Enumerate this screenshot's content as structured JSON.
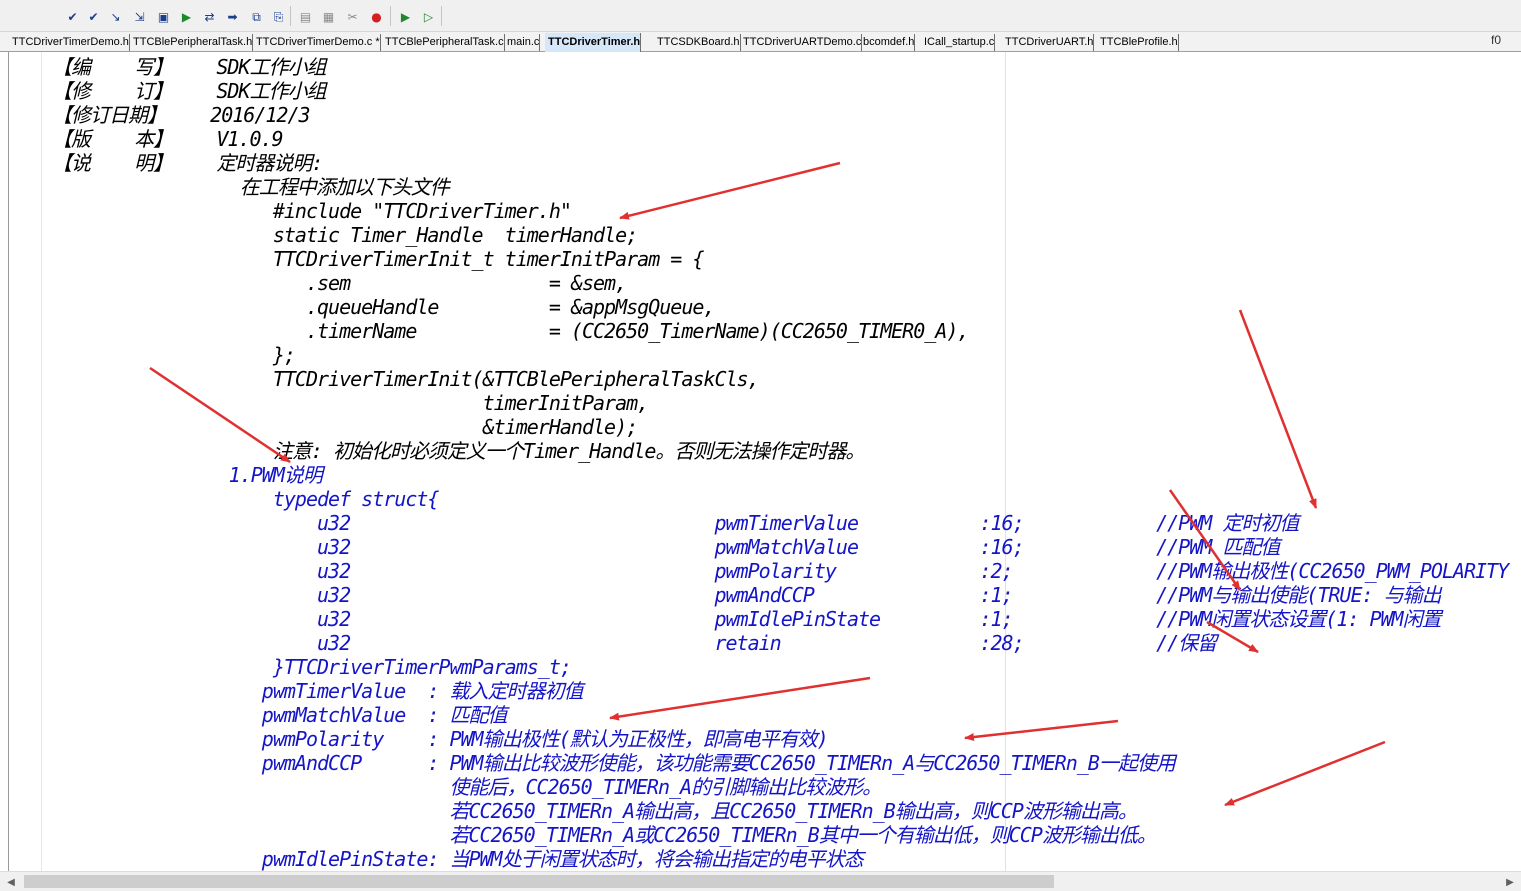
{
  "toolbar": {
    "buttons": [
      {
        "icon": "check-icon",
        "glyph": "✔"
      },
      {
        "icon": "double-check-icon",
        "glyph": "✔"
      },
      {
        "icon": "check-arrow-icon",
        "glyph": "↘"
      },
      {
        "icon": "check-list-icon",
        "glyph": "⇲"
      },
      {
        "icon": "page-icon",
        "glyph": "▣"
      },
      {
        "icon": "play-green-icon",
        "glyph": "▶"
      },
      {
        "icon": "arrows-left-right-icon",
        "glyph": "⇄"
      },
      {
        "icon": "arrow-right-icon",
        "glyph": "➡"
      },
      {
        "icon": "copy-icon",
        "glyph": "⧉"
      },
      {
        "icon": "paste-icon",
        "glyph": "⎘"
      },
      {
        "icon": "doc-gray-icon",
        "glyph": "▤"
      },
      {
        "icon": "grid-icon",
        "glyph": "▦"
      },
      {
        "icon": "scissors-icon",
        "glyph": "✂"
      },
      {
        "icon": "stop-red-icon",
        "glyph": "●"
      },
      {
        "icon": "debug-run-icon",
        "glyph": "▶"
      },
      {
        "icon": "debug-step-icon",
        "glyph": "▷"
      }
    ]
  },
  "tabs": [
    {
      "label": "TTCDriverTimerDemo.h",
      "active": false
    },
    {
      "label": "TTCBlePeripheralTask.h",
      "active": false
    },
    {
      "label": "TTCDriverTimerDemo.c *",
      "active": false
    },
    {
      "label": "TTCBlePeripheralTask.c",
      "active": false
    },
    {
      "label": "main.c",
      "active": false
    },
    {
      "label": "TTCDriverTimer.h",
      "active": true
    },
    {
      "label": "TTCSDKBoard.h",
      "active": false
    },
    {
      "label": "TTCDriverUARTDemo.c",
      "active": false
    },
    {
      "label": "bcomdef.h",
      "active": false
    },
    {
      "label": "ICall_startup.c",
      "active": false
    },
    {
      "label": "TTCDriverUART.h",
      "active": false
    },
    {
      "label": "TTCBleProfile.h",
      "active": false
    }
  ],
  "tab_right_label": "f0",
  "code_lines": [
    {
      "text": "【编    写】    SDK工作小组",
      "color": "black"
    },
    {
      "text": "【修    订】    SDK工作小组",
      "color": "black"
    },
    {
      "text": "【修订日期】    2016/12/3",
      "color": "black"
    },
    {
      "text": "【版    本】    V1.0.9",
      "color": "black"
    },
    {
      "text": "【说    明】    定时器说明:",
      "color": "black"
    },
    {
      "text": "                 在工程中添加以下头文件",
      "color": "black"
    },
    {
      "text": "                    #include \"TTCDriverTimer.h\"",
      "color": "black"
    },
    {
      "text": "                    static Timer_Handle  timerHandle;",
      "color": "black"
    },
    {
      "text": "                    TTCDriverTimerInit_t timerInitParam = {",
      "color": "black"
    },
    {
      "text": "                       .sem                  = &sem,",
      "color": "black"
    },
    {
      "text": "                       .queueHandle          = &appMsgQueue,",
      "color": "black"
    },
    {
      "text": "                       .timerName            = (CC2650_TimerName)(CC2650_TIMER0_A),",
      "color": "black"
    },
    {
      "text": "                    };",
      "color": "black"
    },
    {
      "text": "                    TTCDriverTimerInit(&TTCBlePeripheralTaskCls,",
      "color": "black"
    },
    {
      "text": "                                       timerInitParam,",
      "color": "black"
    },
    {
      "text": "                                       &timerHandle);",
      "color": "black"
    },
    {
      "text": "                    注意: 初始化时必须定义一个Timer_Handle。否则无法操作定时器。",
      "color": "black"
    },
    {
      "text": "                1.PWM说明",
      "color": "blue"
    },
    {
      "text": "                    typedef struct{",
      "color": "blue"
    },
    {
      "text": "                        u32                                 pwmTimerValue           :16;            //PWM 定时初值",
      "color": "blue"
    },
    {
      "text": "                        u32                                 pwmMatchValue           :16;            //PWM 匹配值",
      "color": "blue"
    },
    {
      "text": "                        u32                                 pwmPolarity             :2;             //PWM输出极性(CC2650_PWM_POLARITY",
      "color": "blue"
    },
    {
      "text": "                        u32                                 pwmAndCCP               :1;             //PWM与输出使能(TRUE: 与输出",
      "color": "blue"
    },
    {
      "text": "                        u32                                 pwmIdlePinState         :1;             //PWM闲置状态设置(1: PWM闲置",
      "color": "blue"
    },
    {
      "text": "                        u32                                 retain                  :28;            //保留",
      "color": "blue"
    },
    {
      "text": "                    }TTCDriverTimerPwmParams_t;",
      "color": "blue"
    },
    {
      "text": "                   pwmTimerValue  : 载入定时器初值",
      "color": "blue"
    },
    {
      "text": "                   pwmMatchValue  : 匹配值",
      "color": "blue"
    },
    {
      "text": "                   pwmPolarity    : PWM输出极性(默认为正极性，即高电平有效)",
      "color": "blue"
    },
    {
      "text": "                   pwmAndCCP      : PWM输出比较波形使能，该功能需要CC2650_TIMERn_A与CC2650_TIMERn_B一起使用",
      "color": "blue"
    },
    {
      "text": "                                    使能后，CC2650_TIMERn_A的引脚输出比较波形。",
      "color": "blue"
    },
    {
      "text": "                                    若CC2650_TIMERn_A输出高，且CC2650_TIMERn_B输出高，则CCP波形输出高。",
      "color": "blue"
    },
    {
      "text": "                                    若CC2650_TIMERn_A或CC2650_TIMERn_B其中一个有输出低，则CCP波形输出低。",
      "color": "blue"
    },
    {
      "text": "                   pwmIdlePinState: 当PWM处于闲置状态时，将会输出指定的电平状态",
      "color": "blue"
    }
  ],
  "colors": {
    "code_black": "#000000",
    "code_blue": "#1515c8",
    "annotation_arrow": "#e03030",
    "active_tab": "#d7e7fa"
  },
  "annotations": {
    "count": 10,
    "color": "red",
    "type": "arrow"
  }
}
